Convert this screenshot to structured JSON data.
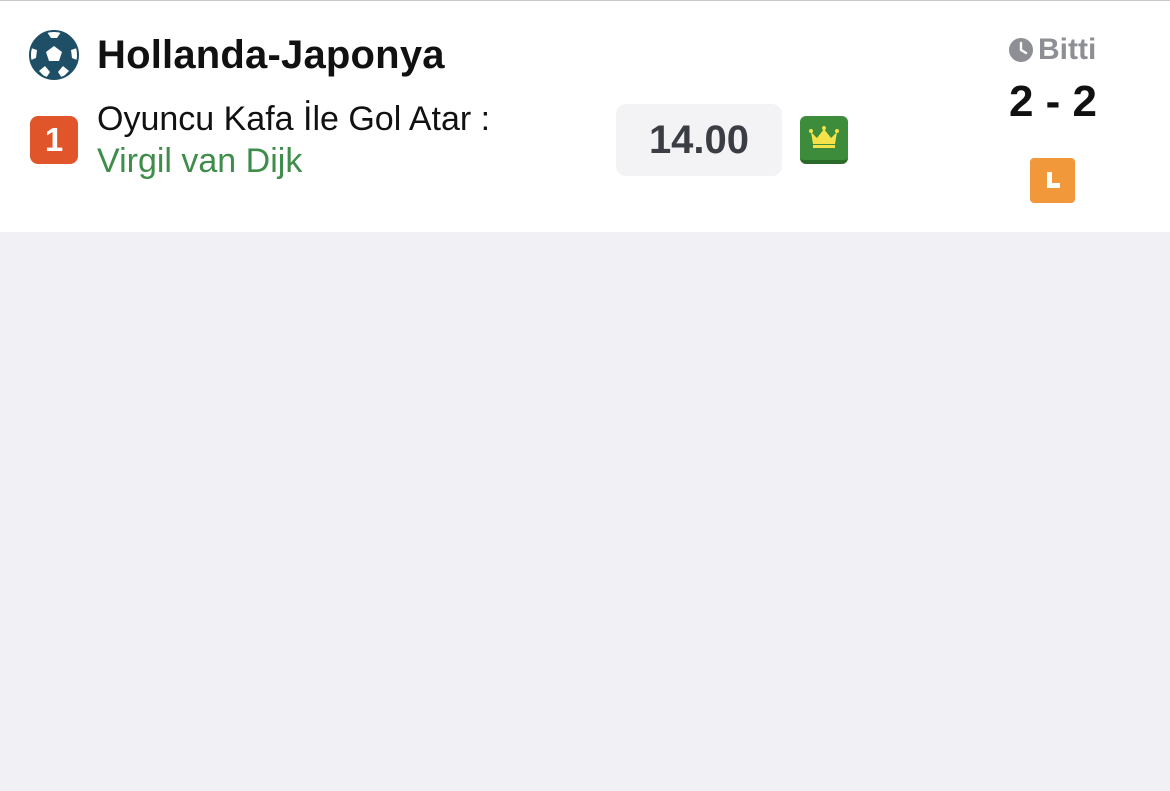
{
  "match": {
    "title": "Hollanda-Japonya",
    "sport_icon": "football-icon"
  },
  "bet": {
    "badge": "1",
    "market": "Oyuncu Kafa İle Gol Atar :",
    "selection": "Virgil van Dijk",
    "odds": "14.00",
    "crown_icon": "crown-icon"
  },
  "result": {
    "status": "Bitti",
    "score": "2 - 2",
    "status_icon": "clock-icon",
    "lost_icon": "l-icon"
  },
  "colors": {
    "badge": "#e0562a",
    "selection": "#3f8d4a",
    "crown_bg": "#3c8c3c",
    "crown": "#f5e14a",
    "live_icon": "#f0983a",
    "background": "#f1f1f5"
  }
}
